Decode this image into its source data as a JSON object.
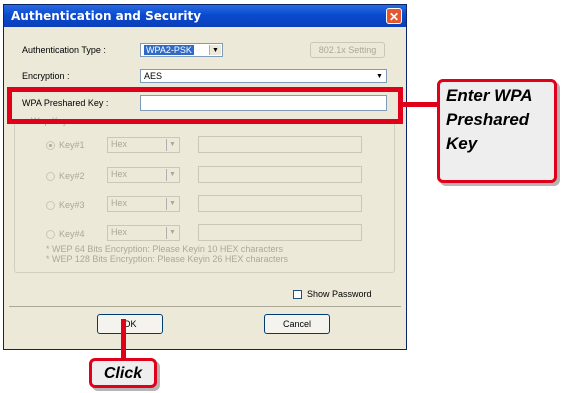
{
  "dialog": {
    "title": "Authentication and Security",
    "close_glyph": "✕"
  },
  "form": {
    "auth_type_label": "Authentication Type :",
    "auth_type_value": "WPA2-PSK",
    "auth_type_arrow": "▼",
    "auth_8021x_button": "802.1x Setting",
    "encryption_label": "Encryption :",
    "encryption_value": "AES",
    "encryption_arrow": "▼",
    "wpa_key_label": "WPA Preshared Key :",
    "wpa_key_value": "",
    "wep_group_label": "Wep Key",
    "wep_keys": [
      {
        "label": "Key#1",
        "format": "Hex",
        "value": "",
        "selected": true
      },
      {
        "label": "Key#2",
        "format": "Hex",
        "value": "",
        "selected": false
      },
      {
        "label": "Key#3",
        "format": "Hex",
        "value": "",
        "selected": false
      },
      {
        "label": "Key#4",
        "format": "Hex",
        "value": "",
        "selected": false
      }
    ],
    "dd_arrow": "▼",
    "wep_note_1": "* WEP 64 Bits Encryption:   Please Keyin 10 HEX characters",
    "wep_note_2": "* WEP 128 Bits Encryption:   Please Keyin 26 HEX characters",
    "show_password_label": "Show Password",
    "show_password_checked": false,
    "ok_button": "OK",
    "cancel_button": "Cancel"
  },
  "annotations": {
    "callout_text": "Enter WPA\nPreshared\nKey",
    "click_text": "Click",
    "accent_color": "#e0001a"
  }
}
